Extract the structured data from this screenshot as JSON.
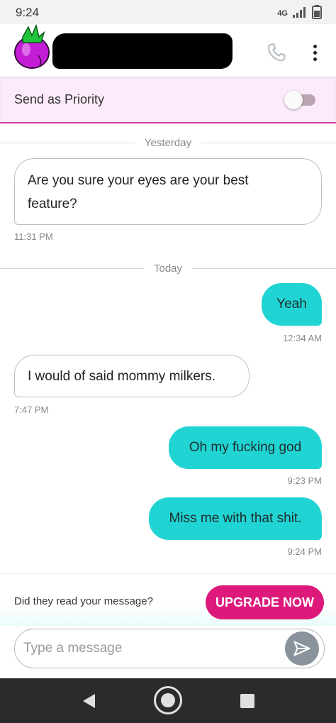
{
  "status_bar": {
    "time": "9:24",
    "network": "4G",
    "icons": [
      "network-type-icon",
      "signal-icon",
      "battery-icon"
    ]
  },
  "header": {
    "contact_name": "",
    "avatar_icon": "eggplant-icon",
    "actions": [
      "phone-icon",
      "more-vert-icon"
    ]
  },
  "priority": {
    "label": "Send as Priority",
    "enabled": false
  },
  "conversation": [
    {
      "type": "divider",
      "label": "Yesterday"
    },
    {
      "type": "message",
      "direction": "incoming",
      "text_lines": [
        "Are you sure your eyes are your best",
        "feature?"
      ],
      "time": "11:31 PM"
    },
    {
      "type": "divider",
      "label": "Today"
    },
    {
      "type": "message",
      "direction": "outgoing",
      "text": "Yeah",
      "time": "12:34 AM"
    },
    {
      "type": "message",
      "direction": "incoming",
      "text": "I would of said mommy milkers.",
      "time": "7:47 PM"
    },
    {
      "type": "message",
      "direction": "outgoing",
      "text": "Oh my fucking god",
      "time": "9:23 PM"
    },
    {
      "type": "message",
      "direction": "outgoing",
      "text": "Miss me with that shit.",
      "time": "9:24 PM"
    }
  ],
  "upgrade": {
    "question": "Did they read your message?",
    "button_label": "UPGRADE NOW"
  },
  "composer": {
    "placeholder": "Type a message",
    "value": "",
    "send_icon": "send-icon"
  },
  "nav_bar": {
    "icons": [
      "back-icon",
      "home-icon",
      "recents-icon"
    ]
  },
  "colors": {
    "accent_pink": "#dd1a7b",
    "outgoing_bubble": "#21d4d4",
    "priority_bg": "#fdeafa",
    "priority_border": "#d6329a",
    "send_button": "#8a939b",
    "nav_bar": "#2b2b2b"
  }
}
